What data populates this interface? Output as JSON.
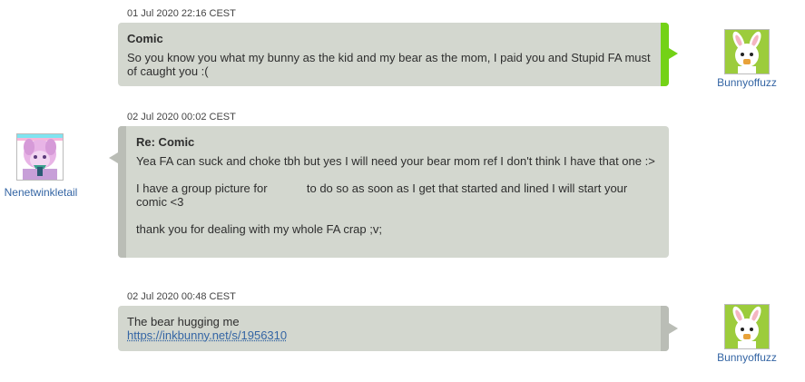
{
  "messages": [
    {
      "timestamp": "01 Jul 2020 22:16 CEST",
      "subject": "Comic",
      "body": [
        "So you know you what my bunny as the kid and my bear as the mom, I paid you and Stupid FA must of caught you :("
      ],
      "author": "Bunnyoffuzz"
    },
    {
      "timestamp": "02 Jul 2020 00:02 CEST",
      "subject": "Re: Comic",
      "body": [
        "Yea FA can suck and choke tbh but yes I will need your bear mom ref I don't think I have that one :>",
        "I have a group picture for            to do so as soon as I get that started and lined I will start your comic <3",
        "thank you for dealing with my whole FA crap ;v;"
      ],
      "author": "Nenetwinkletail"
    },
    {
      "timestamp": "02 Jul 2020 00:48 CEST",
      "body": [
        "The bear hugging me"
      ],
      "link": "https://inkbunny.net/s/1956310",
      "author": "Bunnyoffuzz"
    }
  ],
  "colors": {
    "bubble": "#d3d7cf",
    "unread_accent": "#73d216",
    "read_accent": "#babdb6",
    "username": "#3465a4"
  }
}
